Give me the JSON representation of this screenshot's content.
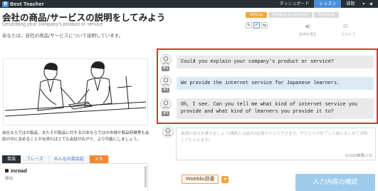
{
  "topbar": {
    "logo_mark": "B",
    "logo_text": "Best Teacher",
    "nav_dashboard": "ダッシュボード",
    "nav_lesson": "レッスン",
    "nav_course": "課題",
    "menu_glyph": "▾",
    "pin_glyph": "◀"
  },
  "header": {
    "title": "会社の商品/サービスの説明をしてみよう",
    "subtitle": "Describing your company's product or service",
    "description": "あなたは、自社の商品/サービスについて説明しています。"
  },
  "skills": {
    "tabs": [
      "Writing",
      "Reading & Listening",
      "Speaking"
    ],
    "active_index": 0,
    "label_audio": "音声を再生",
    "label_skype": "スカイプ"
  },
  "body_text": "自社ならではの製品、またその製品に対する日本ならではの市場や製品特徴等も会話の中に含めることが出来ればとても会話が広がり、より可能にしましょう。",
  "word_tabs": [
    "単語",
    "フレーズ",
    "みんなの英会話",
    "メモ"
  ],
  "word_list": {
    "word": "inroad",
    "meaning": "侵出"
  },
  "dialogue": [
    {
      "num": "#1",
      "speaker": "teacher",
      "text": "Could you explain your company's product or service?"
    },
    {
      "num": "#2",
      "speaker": "student",
      "text": "We provide the internet service for Japanese learners."
    },
    {
      "num": "#3",
      "speaker": "teacher",
      "text": "Oh, I see. Can you tell me what kind of internet service you provide and what kind of learners you provide it to?"
    }
  ],
  "answer": {
    "placeholder": "最適の英文を書きましょう(講師とは最大5往復やりとりできます。やりとりが終了した後にまとめて添削してもらえます)",
    "char_count": "0/100単語入力"
  },
  "weblio_label": "Wweblio辞書",
  "weblio_arrow": "▼",
  "submit_label": "入力内容の確認",
  "colors": {
    "accent_blue": "#4a90d9",
    "highlight_red": "#cf3a2c",
    "tab_orange": "#f3a33b",
    "submit_blue": "#9ecbe9"
  }
}
